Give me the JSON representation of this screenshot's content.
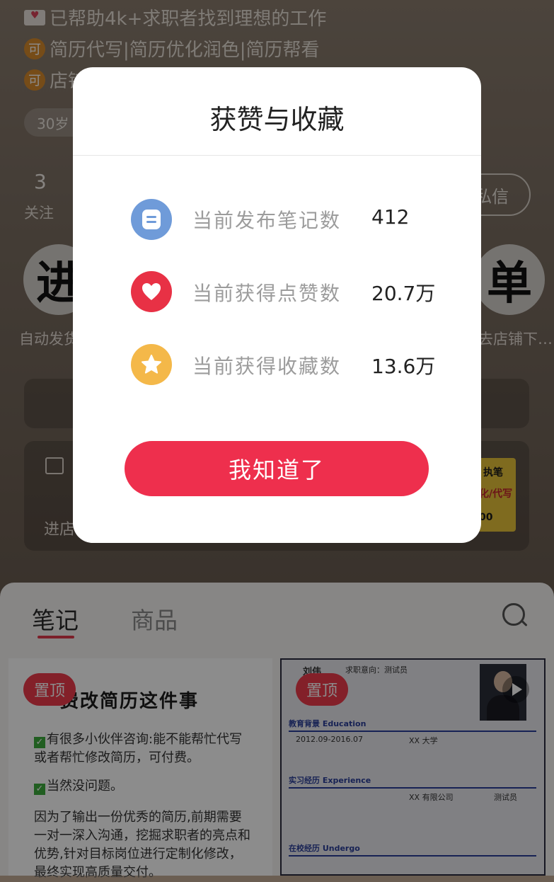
{
  "profile": {
    "bio_lines": [
      "已帮助4k+求职者找到理想的工作",
      "简历代写|简历优化润色|简历帮看",
      "店铺"
    ],
    "badge": "可",
    "age_chip": "30岁",
    "stats": {
      "count": "3",
      "label": "关注"
    },
    "message_button": "私信",
    "left_circle_char": "进",
    "right_circle_char": "单",
    "left_circle_label": "自动发货",
    "right_circle_label": "去店铺下…",
    "store_label": "进店",
    "thumb_text": [
      "执笔",
      "化/代写",
      "00"
    ]
  },
  "modal": {
    "title": "获赞与收藏",
    "rows": [
      {
        "icon": "note-icon",
        "label": "当前发布笔记数",
        "value": "412"
      },
      {
        "icon": "heart-icon",
        "label": "当前获得点赞数",
        "value": "20.7万"
      },
      {
        "icon": "star-icon",
        "label": "当前获得收藏数",
        "value": "13.6万"
      }
    ],
    "confirm_button": "我知道了"
  },
  "tabs": [
    "笔记",
    "商品"
  ],
  "cards": {
    "pin_label": "置顶",
    "card1": {
      "title": "费改简历这件事",
      "paragraphs": [
        "有很多小伙伴咨询:能不能帮忙代写或者帮忙修改简历，可付费。",
        "当然没问题。",
        "因为了输出一份优秀的简历,前期需要一对一深入沟通，挖掘求职者的亮点和优势,针对目标岗位进行定制化修改，最终实现高质量交付。"
      ]
    },
    "resume": {
      "name": "刘伟",
      "intent": "求职意向：测试员",
      "school": "XX 大学",
      "date": "2012.09-2016.07",
      "sections": [
        "教育背景 Education",
        "实习经历 Experience",
        "在校经历 Undergo"
      ],
      "company": "XX 有限公司",
      "role": "测试员"
    }
  },
  "colors": {
    "accent": "#ee2f4d",
    "note_icon_bg": "#6f9bd9",
    "heart_icon_bg": "#e83145",
    "star_icon_bg": "#f4b849"
  }
}
